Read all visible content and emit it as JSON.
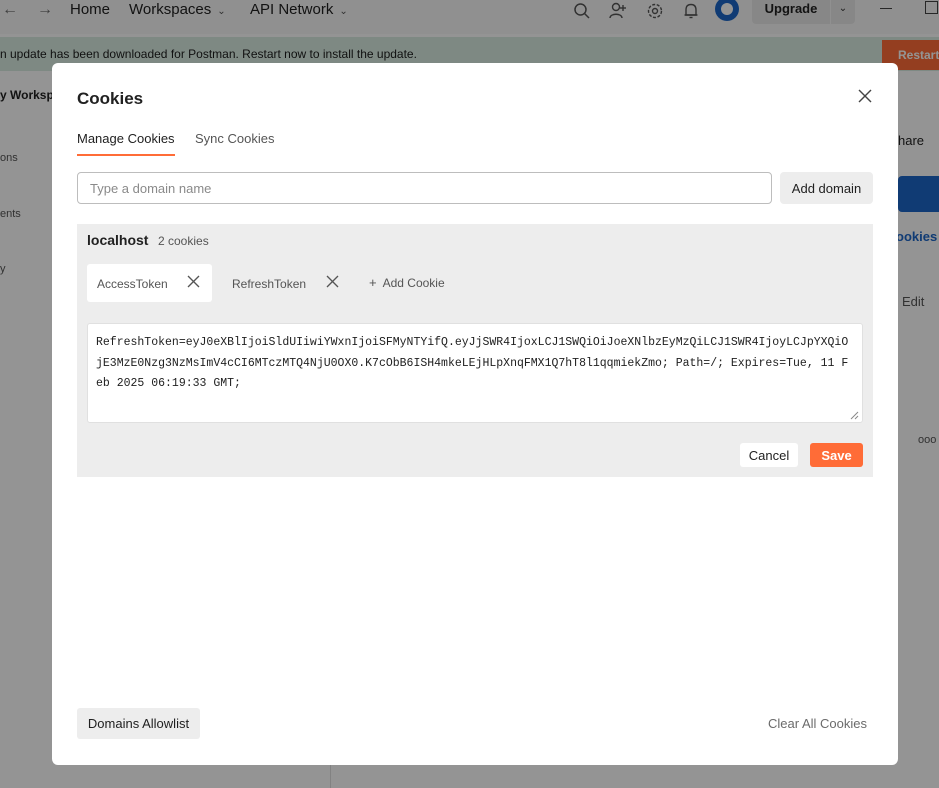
{
  "app_header": {
    "nav": [
      {
        "label": "Home",
        "has_dropdown": false
      },
      {
        "label": "Workspaces",
        "has_dropdown": true
      },
      {
        "label": "API Network",
        "has_dropdown": true
      }
    ],
    "upgrade_label": "Upgrade",
    "icons": [
      "back-arrow-icon",
      "forward-arrow-icon",
      "search-icon",
      "invite-user-icon",
      "settings-gear-icon",
      "notification-bell-icon",
      "avatar",
      "minimize-window-icon",
      "maximize-window-icon"
    ]
  },
  "update_banner": {
    "text": "n update has been downloaded for Postman. Restart now to install the update.",
    "restart_label": "Restart"
  },
  "background": {
    "workspace_name": "y Workspa",
    "sidebar_fragments": [
      "ons",
      "ents",
      "y"
    ],
    "right_fragments": {
      "share": "hare",
      "cookies_link": "ookies",
      "edit": "Edit",
      "more": "ooo"
    }
  },
  "modal": {
    "title": "Cookies",
    "tabs": [
      {
        "label": "Manage Cookies",
        "active": true
      },
      {
        "label": "Sync Cookies",
        "active": false
      }
    ],
    "domain_input": {
      "placeholder": "Type a domain name",
      "value": ""
    },
    "add_domain_label": "Add domain",
    "domain": {
      "name": "localhost",
      "count_text": "2 cookies",
      "cookies": [
        {
          "name": "AccessToken",
          "active": true
        },
        {
          "name": "RefreshToken",
          "active": false
        }
      ],
      "add_cookie_label": "Add Cookie",
      "editor_value": "RefreshToken=eyJ0eXBlIjoiSldUIiwiYWxnIjoiSFMyNTYifQ.eyJjSWR4IjoxLCJ1SWQiOiJoeXNlbzEyMzQiLCJ1SWR4IjoyLCJpYXQiOjE3MzE0Nzg3NzMsImV4cCI6MTczMTQ4NjU0OX0.K7cObB6ISH4mkeLEjHLpXnqFMX1Q7hT8l1qqmiekZmo; Path=/; Expires=Tue, 11 Feb 2025 06:19:33 GMT;"
    },
    "cancel_label": "Cancel",
    "save_label": "Save",
    "allowlist_label": "Domains Allowlist",
    "clear_all_label": "Clear All Cookies"
  },
  "colors": {
    "accent": "#ff6c37",
    "banner_bg": "#d9ede2",
    "panel_bg": "#ededed",
    "overlay": "rgba(0,0,0,0.42)"
  }
}
